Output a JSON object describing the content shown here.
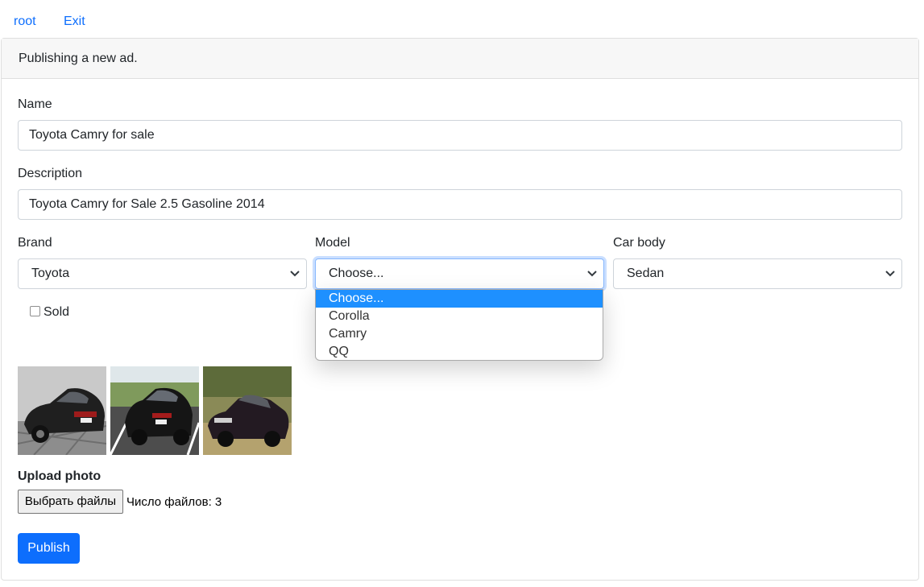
{
  "nav": {
    "user": "root",
    "exit": "Exit"
  },
  "card": {
    "header": "Publishing a new ad."
  },
  "form": {
    "name": {
      "label": "Name",
      "value": "Toyota Camry for sale"
    },
    "description": {
      "label": "Description",
      "value": "Toyota Camry for Sale 2.5 Gasoline 2014"
    },
    "brand": {
      "label": "Brand",
      "value": "Toyota"
    },
    "model": {
      "label": "Model",
      "value": "Choose...",
      "options": [
        "Choose...",
        "Corolla",
        "Camry",
        "QQ"
      ]
    },
    "car_body": {
      "label": "Car body",
      "value": "Sedan"
    },
    "sold": {
      "label": "Sold",
      "checked": false
    },
    "upload": {
      "label": "Upload photo",
      "button": "Выбрать файлы",
      "status": "Число файлов: 3"
    },
    "publish": "Publish"
  },
  "colors": {
    "accent": "#0d6efd",
    "option_highlight": "#1e90ff"
  },
  "icons": [
    "chevron-down-icon",
    "car-photo"
  ]
}
